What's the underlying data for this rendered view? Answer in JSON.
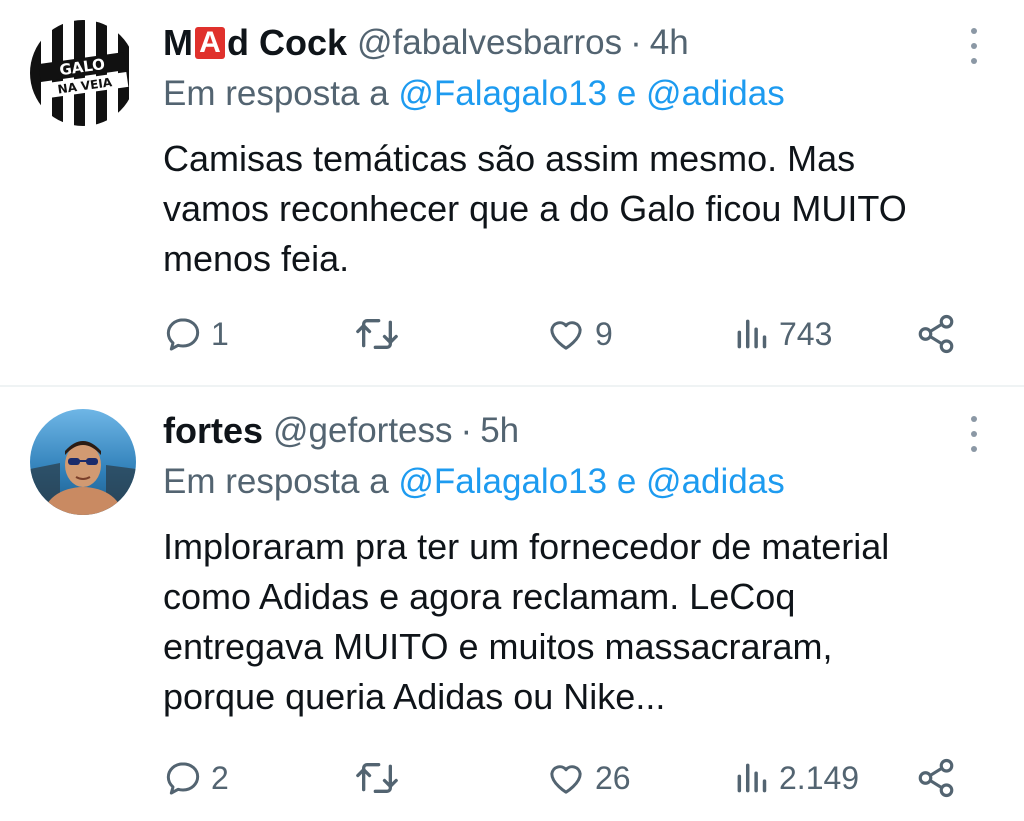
{
  "tweets": [
    {
      "display_name_pre": "M",
      "display_name_badge": "A",
      "display_name_post": "d Cock",
      "handle": "@fabalvesbarros",
      "separator": "·",
      "time": "4h",
      "reply_prefix": "Em resposta a",
      "reply_mention_1": "@Falagalo13",
      "reply_conj": "e",
      "reply_mention_2": "@adidas",
      "avatar_text_1": "GALO",
      "avatar_text_2": "NA VEIA",
      "text_lines": [
        "Camisas temáticas são assim mesmo. Mas",
        "vamos reconhecer que a do Galo ficou MUITO",
        "menos feia."
      ],
      "replies": "1",
      "retweets": "",
      "likes": "9",
      "views": "743"
    },
    {
      "display_name": "fortes",
      "handle": "@gefortess",
      "separator": "·",
      "time": "5h",
      "reply_prefix": "Em resposta a",
      "reply_mention_1": "@Falagalo13",
      "reply_conj": "e",
      "reply_mention_2": "@adidas",
      "text_lines": [
        "Imploraram pra ter um fornecedor de material",
        "como Adidas e agora reclamam. LeCoq",
        "entregava MUITO e muitos massacraram,",
        "porque queria Adidas ou Nike..."
      ],
      "replies": "2",
      "retweets": "",
      "likes": "26",
      "views": "2.149"
    }
  ],
  "icons": {
    "reply": "reply-icon",
    "retweet": "retweet-icon",
    "like": "heart-icon",
    "views": "views-icon",
    "share": "share-icon",
    "more": "more-icon"
  },
  "colors": {
    "text": "#0f1419",
    "muted": "#536471",
    "link": "#1d9bf0",
    "badge": "#e0312c",
    "divider": "#eff3f4"
  }
}
